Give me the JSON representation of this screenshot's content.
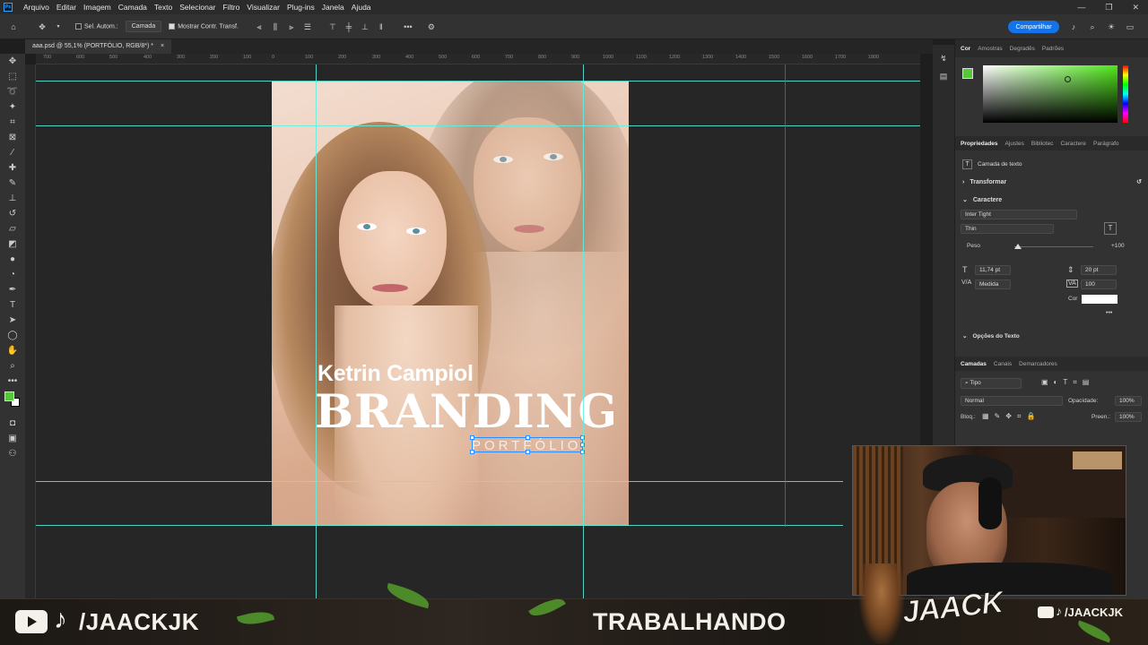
{
  "menubar": {
    "items": [
      "Arquivo",
      "Editar",
      "Imagem",
      "Camada",
      "Texto",
      "Selecionar",
      "Filtro",
      "Visualizar",
      "Plug-ins",
      "Janela",
      "Ajuda"
    ]
  },
  "options": {
    "auto_select_label": "Sel. Autom.:",
    "auto_select_value": "Camada",
    "show_transform_label": "Mostrar Contr. Transf.",
    "share_label": "Compartilhar"
  },
  "document": {
    "tab_title": "aaa.psd @ 55,1% (PORTFÓLIO, RGB/8*) *",
    "tab_close": "×"
  },
  "ruler": {
    "ticks": [
      "700",
      "600",
      "500",
      "400",
      "300",
      "200",
      "100",
      "0",
      "100",
      "200",
      "300",
      "400",
      "500",
      "600",
      "700",
      "800",
      "900",
      "1000",
      "1100",
      "1200",
      "1300",
      "1400",
      "1500",
      "1600",
      "1700",
      "1800"
    ]
  },
  "artwork": {
    "name": "Ketrin Campiol",
    "headline": "BRANDING",
    "subtitle": "PORTFÓLIO"
  },
  "color_panel": {
    "tabs": [
      "Cor",
      "Amostras",
      "Degradês",
      "Padrões"
    ],
    "foreground": "#55c83a",
    "background": "#ffffff"
  },
  "properties": {
    "tabs": [
      "Propriedades",
      "Ajustes",
      "Bibliotec",
      "Caractere",
      "Parágrafo"
    ],
    "layer_type": "Camada de texto",
    "transform_label": "Transformar",
    "character_label": "Caractere",
    "font_family": "Inter Tight",
    "font_style": "Thin",
    "weight_label": "Peso",
    "weight_value": "+100",
    "font_size": "11,74 pt",
    "leading": "20 pt",
    "kerning": "Medida",
    "tracking": "100",
    "color_label": "Cor",
    "more": "•••",
    "text_options": "Opções do Texto"
  },
  "layers": {
    "tabs": [
      "Camadas",
      "Canais",
      "Demarcadores"
    ],
    "filter": "Tipo",
    "blend_mode": "Normal",
    "opacity_label": "Opacidade:",
    "opacity_value": "100%",
    "lock_label": "Bloq.:",
    "fill_label": "Preen.:",
    "fill_value": "100%"
  },
  "stream": {
    "social_handle": "/JAACKJK",
    "status": "TRABALHANDO",
    "brand_logo": "JAACK",
    "small_handle": "/JAACKJK"
  },
  "colors": {
    "guide": "#5ef0e0",
    "selection": "#2d8cff",
    "share_button": "#1473e6"
  }
}
